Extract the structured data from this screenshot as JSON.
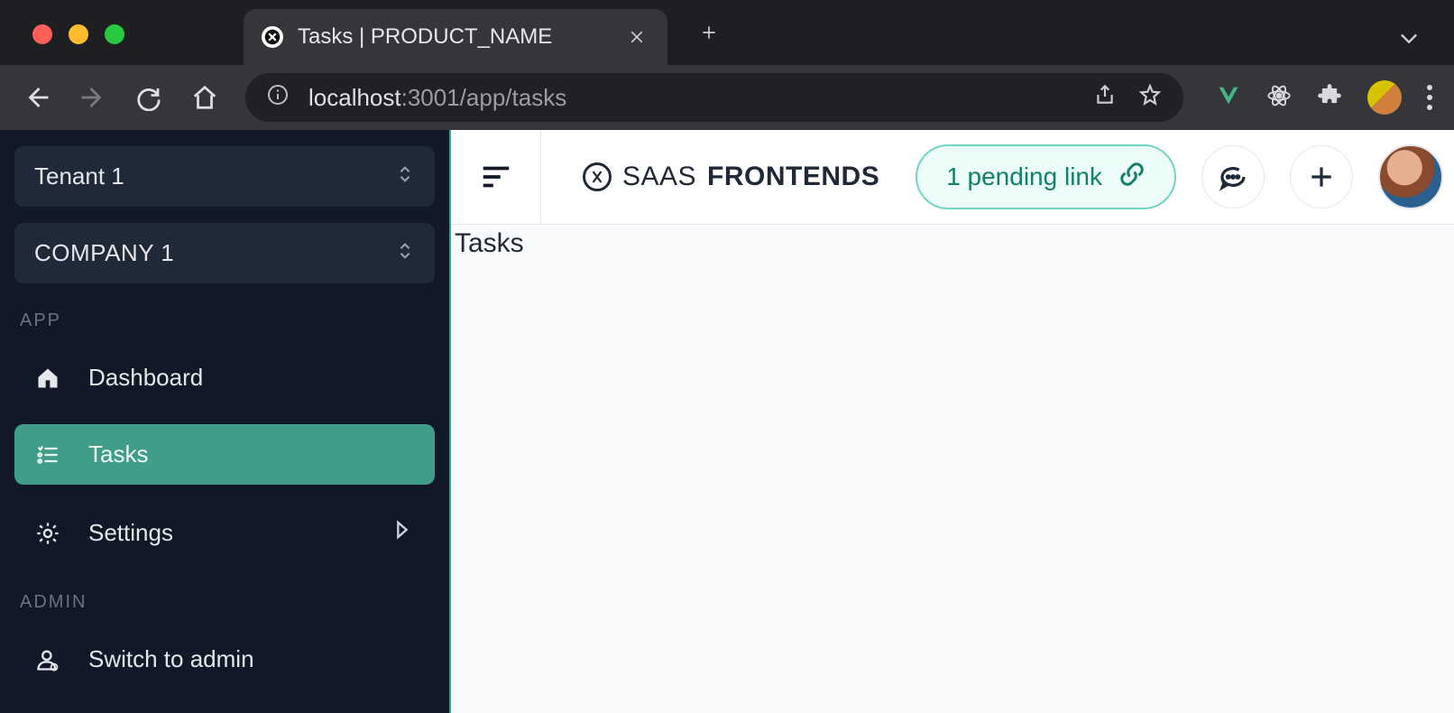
{
  "browser": {
    "tab_title": "Tasks | PRODUCT_NAME",
    "url_host": "localhost",
    "url_port": ":3001",
    "url_path": "/app/tasks"
  },
  "sidebar": {
    "tenant_label": "Tenant 1",
    "company_label": "COMPANY 1",
    "section_app": "APP",
    "section_admin": "ADMIN",
    "items": {
      "dashboard": "Dashboard",
      "tasks": "Tasks",
      "settings": "Settings",
      "switch_admin": "Switch to admin"
    }
  },
  "header": {
    "brand_prefix": "SAAS",
    "brand_suffix": "FRONTENDS",
    "pending_link": "1 pending link"
  },
  "content": {
    "page_title": "Tasks"
  }
}
